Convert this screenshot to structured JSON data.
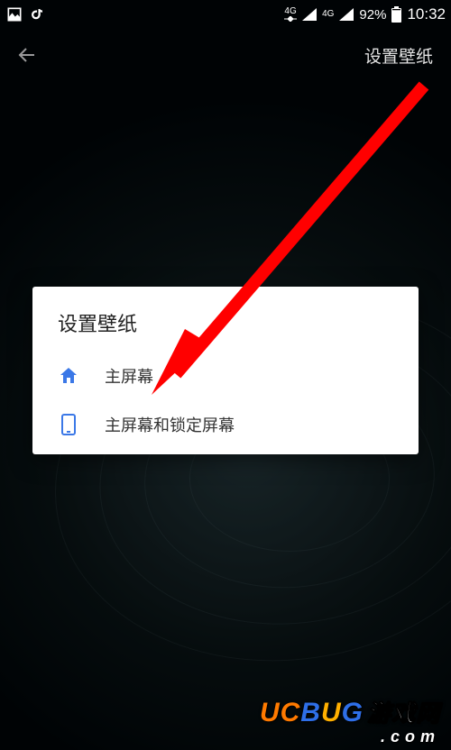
{
  "statusbar": {
    "network_label": "4G",
    "battery_percent": "92%",
    "clock": "10:32"
  },
  "appbar": {
    "title": "设置壁纸"
  },
  "dialog": {
    "title": "设置壁纸",
    "options": [
      {
        "icon": "home-icon",
        "label": "主屏幕"
      },
      {
        "icon": "phone-icon",
        "label": "主屏幕和锁定屏幕"
      }
    ]
  },
  "watermark": {
    "brand_u": "U",
    "brand_c": "C",
    "brand_b": "B",
    "brand_u2": "U",
    "brand_g": "G",
    "brand_cn": "游戏网",
    "domain": ".com"
  }
}
